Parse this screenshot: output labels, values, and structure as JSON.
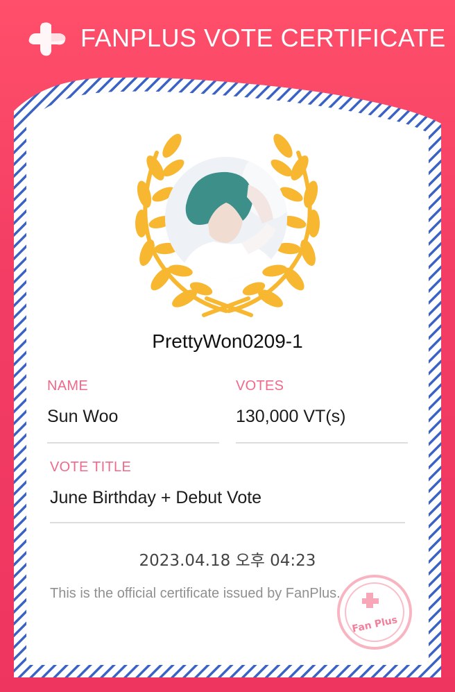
{
  "header": {
    "title": "FANPLUS VOTE CERTIFICATE",
    "logo_icon": "fanplus-cross-logo-icon"
  },
  "certificate": {
    "username": "PrettyWon0209-1",
    "name_label": "NAME",
    "name_value": "Sun Woo",
    "votes_label": "VOTES",
    "votes_value": "130,000 VT(s)",
    "vote_title_label": "VOTE TITLE",
    "vote_title_value": "June Birthday + Debut Vote",
    "datetime": "2023.04.18 오후 04:23",
    "notice": "This is the official certificate issued by FanPlus."
  },
  "stamp": {
    "text": "Fan Plus",
    "icon": "fanplus-seal-icon"
  },
  "colors": {
    "brand_pink": "#ef3a63",
    "label_pink": "#f0698a",
    "wreath_gold": "#f7b731",
    "border_blue": "#3a62c4"
  }
}
